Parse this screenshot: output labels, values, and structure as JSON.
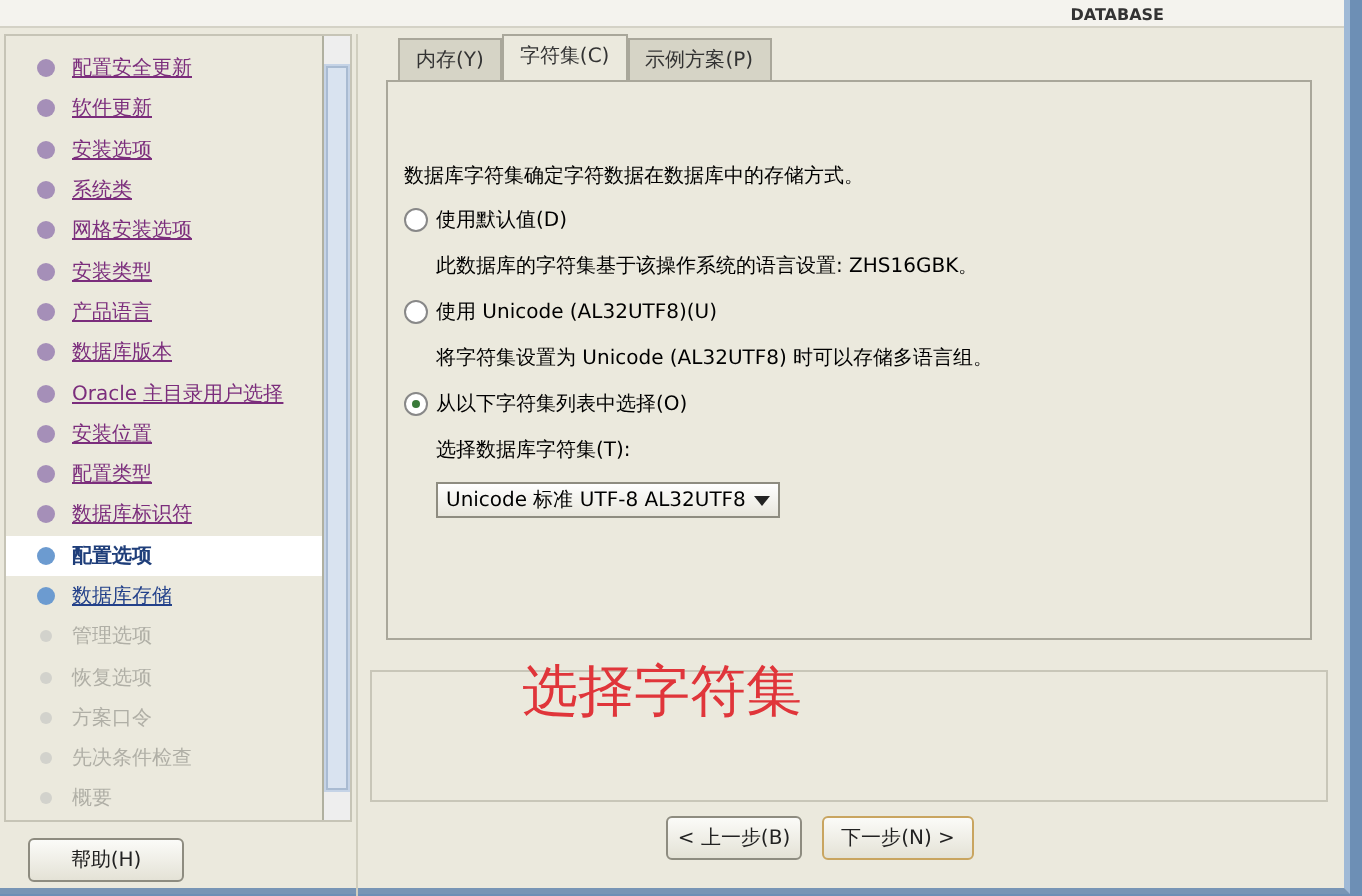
{
  "header": {
    "brand": "DATABASE"
  },
  "steps": [
    {
      "label": "配置安全更新",
      "kind": "done"
    },
    {
      "label": "软件更新",
      "kind": "done"
    },
    {
      "label": "安装选项",
      "kind": "done"
    },
    {
      "label": "系统类",
      "kind": "done"
    },
    {
      "label": "网格安装选项",
      "kind": "done"
    },
    {
      "label": "安装类型",
      "kind": "done"
    },
    {
      "label": "产品语言",
      "kind": "done"
    },
    {
      "label": "数据库版本",
      "kind": "done"
    },
    {
      "label": "Oracle 主目录用户选择",
      "kind": "done"
    },
    {
      "label": "安装位置",
      "kind": "done"
    },
    {
      "label": "配置类型",
      "kind": "done"
    },
    {
      "label": "数据库标识符",
      "kind": "done"
    },
    {
      "label": "配置选项",
      "kind": "current"
    },
    {
      "label": "数据库存储",
      "kind": "available"
    },
    {
      "label": "管理选项",
      "kind": "pending"
    },
    {
      "label": "恢复选项",
      "kind": "pending"
    },
    {
      "label": "方案口令",
      "kind": "pending"
    },
    {
      "label": "先决条件检查",
      "kind": "pending"
    },
    {
      "label": "概要",
      "kind": "pending"
    }
  ],
  "help_button": "帮助(H)",
  "tabs": [
    {
      "label": "内存(Y)",
      "selected": false
    },
    {
      "label": "字符集(C)",
      "selected": true
    },
    {
      "label": "示例方案(P)",
      "selected": false
    }
  ],
  "intro": "数据库字符集确定字符数据在数据库中的存储方式。",
  "options": [
    {
      "label": "使用默认值(D)",
      "selected": false,
      "note": "此数据库的字符集基于该操作系统的语言设置: ZHS16GBK。"
    },
    {
      "label": "使用 Unicode (AL32UTF8)(U)",
      "selected": false,
      "note": "将字符集设置为 Unicode (AL32UTF8) 时可以存储多语言组。"
    },
    {
      "label": "从以下字符集列表中选择(O)",
      "selected": true
    }
  ],
  "charset_label": "选择数据库字符集(T):",
  "charset_value": "Unicode 标准 UTF-8 AL32UTF8",
  "annotation": "选择字符集",
  "nav_buttons": [
    "< 上一步(B)",
    "下一步(N) >"
  ]
}
